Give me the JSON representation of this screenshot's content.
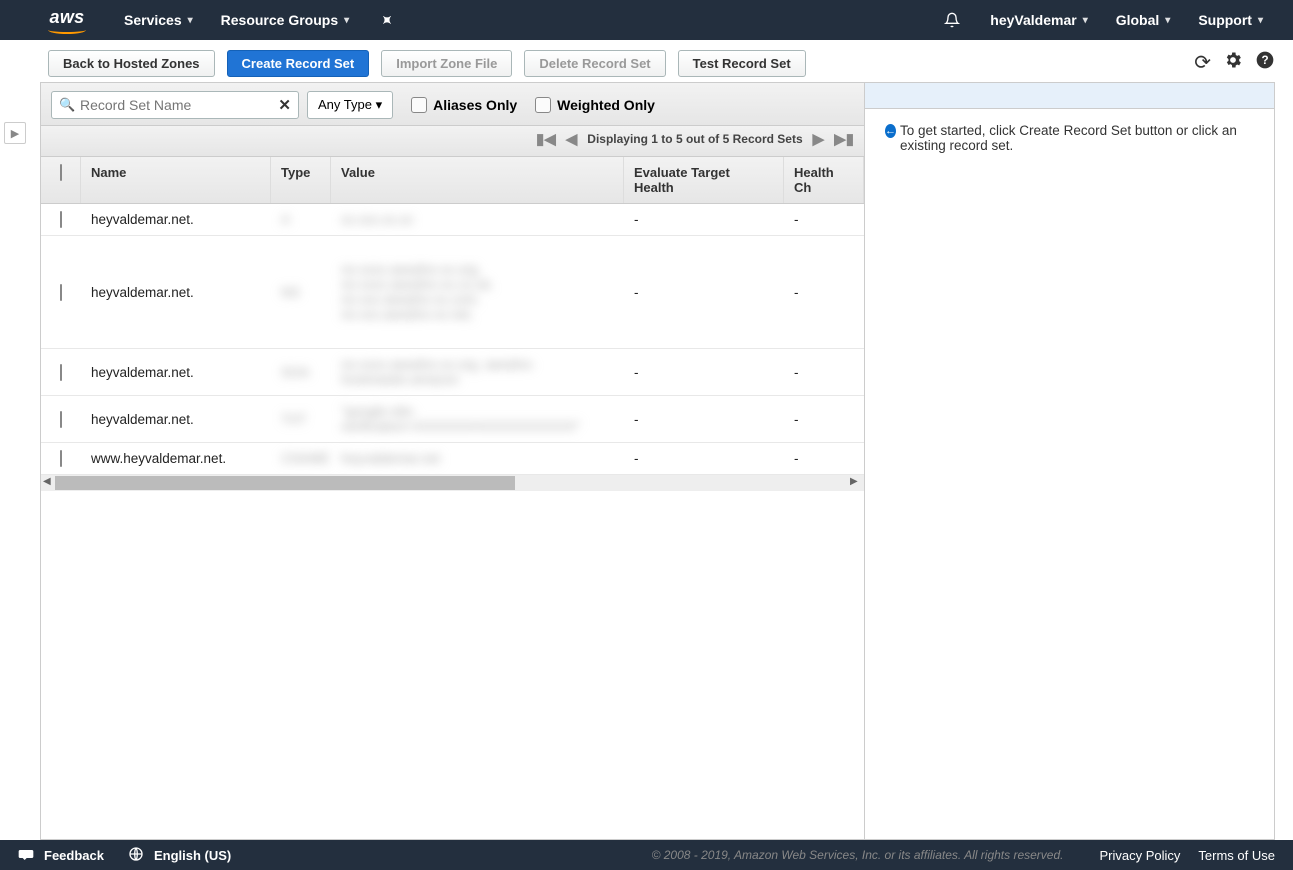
{
  "topnav": {
    "logo": "aws",
    "services": "Services",
    "resource_groups": "Resource Groups",
    "user": "heyValdemar",
    "region": "Global",
    "support": "Support"
  },
  "actions": {
    "back": "Back to Hosted Zones",
    "create": "Create Record Set",
    "import": "Import Zone File",
    "delete": "Delete Record Set",
    "test": "Test Record Set"
  },
  "filter": {
    "placeholder": "Record Set Name",
    "type_select": "Any Type",
    "aliases_only": "Aliases Only",
    "weighted_only": "Weighted Only"
  },
  "pager": {
    "text": "Displaying 1 to 5 out of 5 Record Sets"
  },
  "columns": {
    "name": "Name",
    "type": "Type",
    "value": "Value",
    "eth": "Evaluate Target Health",
    "hc": "Health Ch"
  },
  "rows": [
    {
      "name": "heyvaldemar.net.",
      "eth": "-",
      "hc": "-"
    },
    {
      "name": "heyvaldemar.net.",
      "eth": "-",
      "hc": "-"
    },
    {
      "name": "heyvaldemar.net.",
      "eth": "-",
      "hc": "-"
    },
    {
      "name": "heyvaldemar.net.",
      "eth": "-",
      "hc": "-"
    },
    {
      "name": "www.heyvaldemar.net.",
      "eth": "-",
      "hc": "-"
    }
  ],
  "side": {
    "info": "To get started, click Create Record Set button or click an existing record set."
  },
  "footer": {
    "feedback": "Feedback",
    "language": "English (US)",
    "copyright": "© 2008 - 2019, Amazon Web Services, Inc. or its affiliates. All rights reserved.",
    "privacy": "Privacy Policy",
    "terms": "Terms of Use"
  }
}
